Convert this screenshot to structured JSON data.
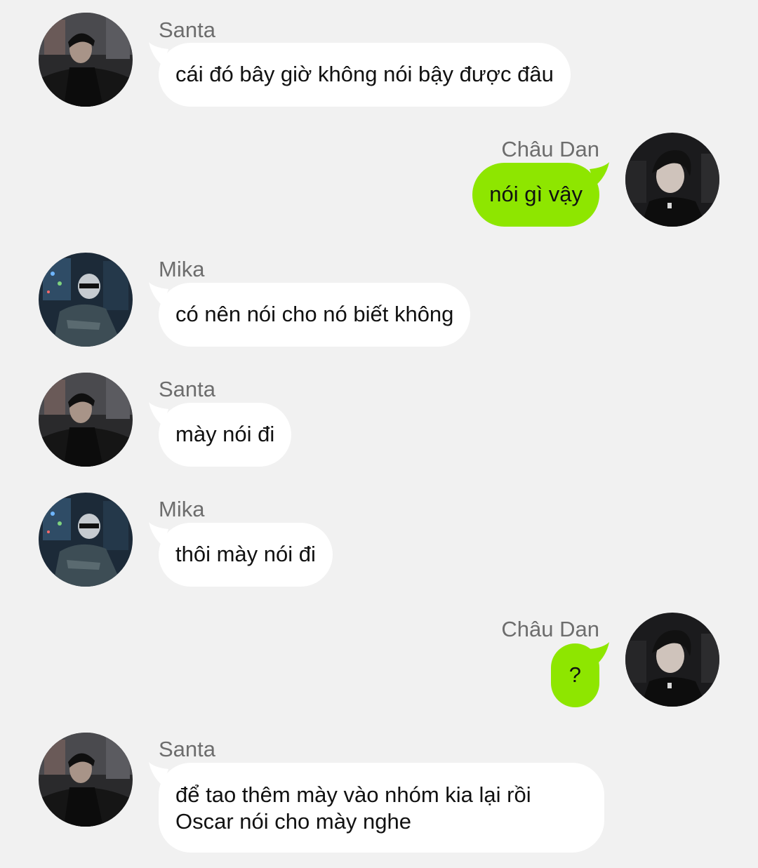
{
  "colors": {
    "background": "#f1f1f1",
    "incoming_bubble": "#ffffff",
    "outgoing_bubble": "#8ee600",
    "sender_name": "#6d6d6d"
  },
  "messages": [
    {
      "sender": "Santa",
      "side": "left",
      "avatar": "santa-avatar",
      "text": "cái đó bây giờ không nói bậy được đâu"
    },
    {
      "sender": "Châu Dan",
      "side": "right",
      "avatar": "chau-dan-avatar",
      "text": "nói gì vậy"
    },
    {
      "sender": "Mika",
      "side": "left",
      "avatar": "mika-avatar",
      "text": "có nên nói cho nó biết không"
    },
    {
      "sender": "Santa",
      "side": "left",
      "avatar": "santa-avatar",
      "text": "mày nói đi"
    },
    {
      "sender": "Mika",
      "side": "left",
      "avatar": "mika-avatar",
      "text": "thôi mày nói đi"
    },
    {
      "sender": "Châu Dan",
      "side": "right",
      "avatar": "chau-dan-avatar",
      "text": "?"
    },
    {
      "sender": "Santa",
      "side": "left",
      "avatar": "santa-avatar",
      "text": "để tao thêm mày vào nhóm kia lại rồi\nOscar nói cho mày nghe"
    }
  ]
}
